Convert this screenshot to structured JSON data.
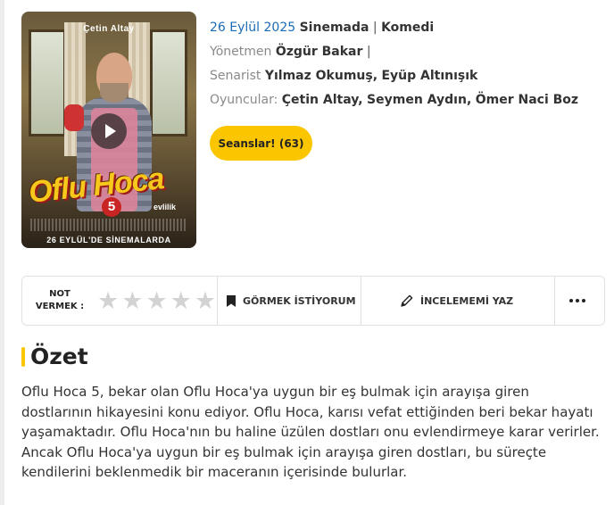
{
  "poster": {
    "actor_name": "Çetin Altay",
    "logo_text": "Oflu Hoca",
    "logo_number": "5",
    "logo_subtitle": "evlilik",
    "bottom_text": "26 EYLÜL'DE SİNEMALARDA",
    "play_icon": "play-icon"
  },
  "meta": {
    "date": "26 Eylül 2025",
    "release_type": "Sinemada",
    "separator": "|",
    "genre": "Komedi",
    "director_label": "Yönetmen",
    "director": "Özgür Bakar",
    "director_sep": "|",
    "writer_label": "Senarist",
    "writers": [
      "Yılmaz Okumuş",
      "Eyüp Altınışık"
    ],
    "cast_label": "Oyuncular:",
    "cast": [
      "Çetin Altay",
      "Seymen Aydın",
      "Ömer Naci Boz"
    ]
  },
  "seanslar_button": "Seanslar! (63)",
  "actions": {
    "rate_label_line1": "NOT",
    "rate_label_line2": "VERMEK :",
    "star_count": 5,
    "stars_filled": 0,
    "want_label": "GÖRMEK İSTİYORUM",
    "want_icon": "bookmark-icon",
    "review_label": "İNCELEMEMİ YAZ",
    "review_icon": "pencil-icon",
    "more_icon": "more-dots-icon"
  },
  "summary": {
    "title": "Özet",
    "text": "Oflu Hoca 5, bekar olan Oflu Hoca'ya uygun bir eş bulmak için arayışa giren dostlarının hikayesini konu ediyor. Oflu Hoca, karısı vefat ettiğinden beri bekar hayatı yaşamaktadır. Oflu Hoca'nın bu haline üzülen dostları onu evlendirmeye karar verirler. Ancak Oflu Hoca'ya uygun bir eş bulmak için arayışa giren dostları, bu süreçte kendilerini beklenmedik bir maceranın içerisinde bulurlar."
  },
  "colors": {
    "accent": "#fbc600",
    "link_blue": "#1a6bb6",
    "star_empty": "#d3d3d3"
  }
}
